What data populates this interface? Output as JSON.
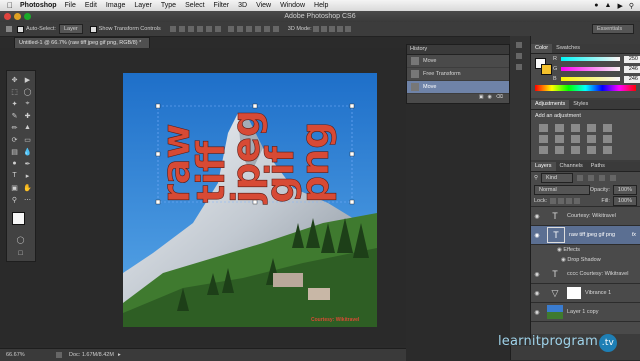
{
  "menubar": {
    "app_name": "Photoshop",
    "items": [
      "File",
      "Edit",
      "Image",
      "Layer",
      "Type",
      "Select",
      "Filter",
      "3D",
      "View",
      "Window",
      "Help"
    ]
  },
  "window": {
    "title": "Adobe Photoshop CS6"
  },
  "options_bar": {
    "auto_select_label": "Auto-Select:",
    "auto_select_value": "Layer",
    "show_transform_label": "Show Transform Controls",
    "mode_3d_label": "3D Mode:",
    "workspace": "Essentials"
  },
  "document": {
    "tab_title": "Untitled-1 @ 66.7% (raw tiff jpeg gif png, RGB/8) *",
    "zoom": "66.67%",
    "doc_size": "Doc: 1.67M/8.42M",
    "text_words": [
      "raw",
      "tiff",
      "jpeg",
      "gif",
      "png"
    ],
    "credit": "Courtesy: Wikitravel"
  },
  "history": {
    "title": "History",
    "items": [
      "Move",
      "Free Transform",
      "Move"
    ]
  },
  "color_panel": {
    "tabs": [
      "Color",
      "Swatches"
    ],
    "channels": [
      {
        "label": "R",
        "value": "250"
      },
      {
        "label": "G",
        "value": "246"
      },
      {
        "label": "B",
        "value": "246"
      }
    ]
  },
  "adjustments": {
    "tabs": [
      "Adjustments",
      "Styles"
    ],
    "heading": "Add an adjustment"
  },
  "layers_panel": {
    "tabs": [
      "Layers",
      "Channels",
      "Paths"
    ],
    "kind_label": "Kind",
    "blend_mode": "Normal",
    "opacity_label": "Opacity:",
    "opacity_value": "100%",
    "lock_label": "Lock:",
    "fill_label": "Fill:",
    "fill_value": "100%",
    "layers": [
      {
        "name": "Courtesy: Wikitravel",
        "type": "T"
      },
      {
        "name": "raw tiff jpeg gif png",
        "type": "T",
        "fx": "fx"
      },
      {
        "name": "Effects",
        "type": "sub"
      },
      {
        "name": "Drop Shadow",
        "type": "sub"
      },
      {
        "name": "cccc Courtesy: Wikitravel",
        "type": "T"
      },
      {
        "name": "Vibrance 1",
        "type": "adj"
      },
      {
        "name": "Layer 1 copy",
        "type": "img"
      }
    ]
  },
  "watermark": {
    "text": "learnitprogram",
    "suffix": ".tv"
  }
}
